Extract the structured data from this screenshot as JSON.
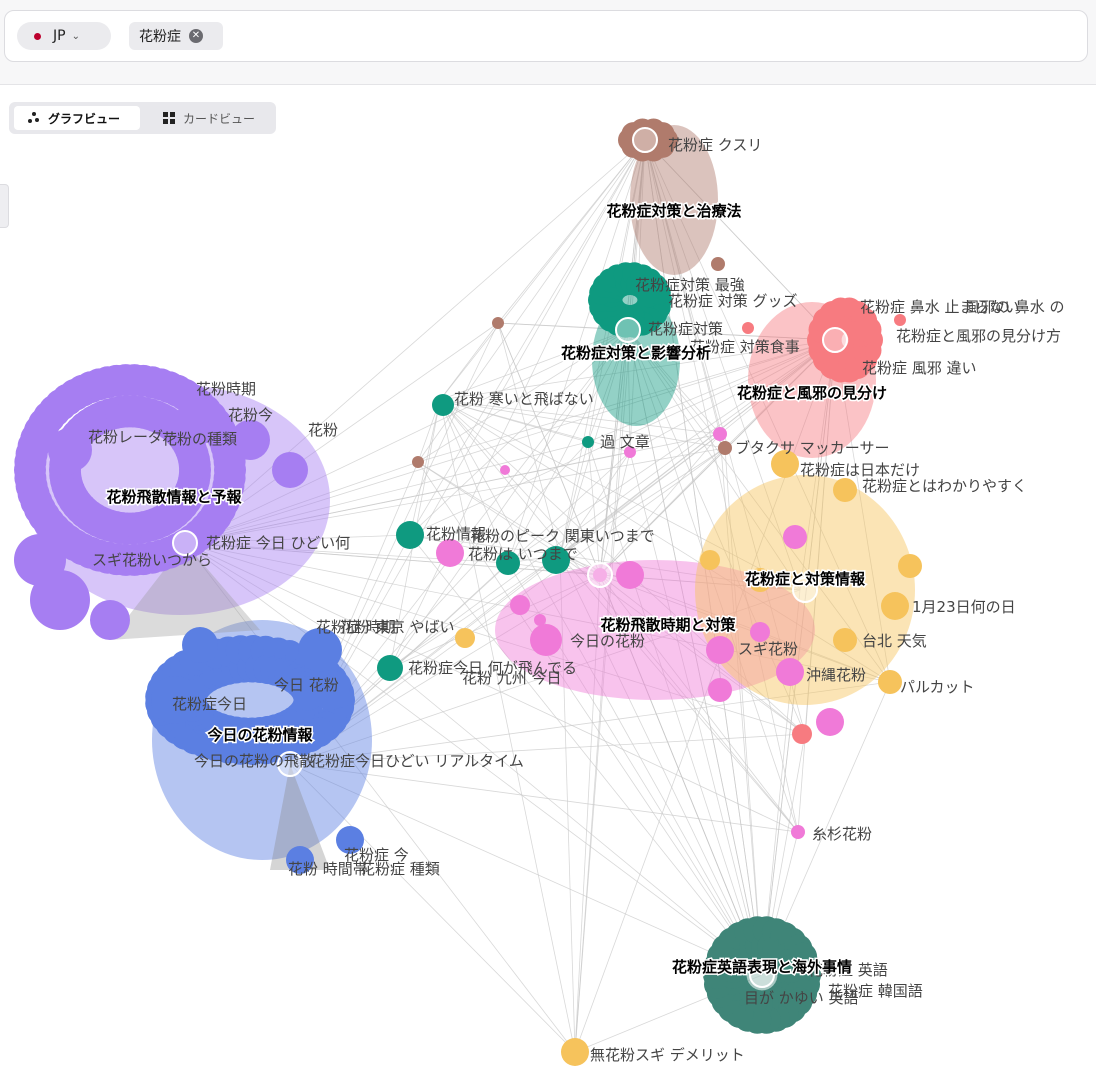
{
  "search": {
    "country_code": "JP",
    "keyword": "花粉症",
    "flag_icon": "japan-flag-icon",
    "remove_icon": "close-circle-icon"
  },
  "view_toggle": {
    "graph_label": "グラフビュー",
    "card_label": "カードビュー",
    "active": "graph"
  },
  "colors": {
    "purple": "#a67ef2",
    "blue": "#5b7fe2",
    "brown": "#b07b6c",
    "teal": "#0f9a80",
    "red": "#f77b80",
    "pink": "#f07ad8",
    "orange": "#f6c35c",
    "darkteal": "#3f8578",
    "edge": "#c8c8c8"
  },
  "clusters": [
    {
      "id": "purple",
      "label": "花粉飛散情報と予報",
      "color": "purple"
    },
    {
      "id": "blue",
      "label": "今日の花粉情報",
      "color": "blue"
    },
    {
      "id": "brown",
      "label": "花粉症対策と治療法",
      "color": "brown"
    },
    {
      "id": "teal",
      "label": "花粉症対策と影響分析",
      "color": "teal"
    },
    {
      "id": "red",
      "label": "花粉症と風邪の見分け",
      "color": "red"
    },
    {
      "id": "pink",
      "label": "花粉飛散時期と対策",
      "color": "pink"
    },
    {
      "id": "orange",
      "label": "花粉症と対策情報",
      "color": "orange"
    },
    {
      "id": "darkteal",
      "label": "花粉症英語表現と海外事情",
      "color": "darkteal"
    }
  ],
  "node_labels": [
    "花粉症 クスリ",
    "花粉症対策 最強",
    "花粉症 対策 グッズ",
    "花粉症対策",
    "花粉症 対策食事",
    "花粉症 鼻水 止まらない",
    "風邪の 鼻水 の",
    "花粉症と風邪の見分け方",
    "花粉症 風邪 違い",
    "花粉時期",
    "花粉今",
    "花粉",
    "花粉レーダー",
    "花粉の種類",
    "花粉 寒いと飛ばない",
    "過 文章",
    "ブタクサ マッカーサー",
    "花粉症は日本だけ",
    "花粉症とはわかりやすく",
    "花粉症 今日 ひどい何",
    "スギ花粉いつから",
    "花粉情報",
    "花粉のピーク 関東いつまで",
    "花粉は いつまで",
    "スギ花粉",
    "1月23日何の日",
    "台北 天気",
    "今日の花粉",
    "花粉症 時期",
    "花粉 東京 やばい",
    "花粉症今日 何が飛んでる",
    "花粉 九州 今日",
    "沖縄花粉",
    "パルカット",
    "花粉症今日",
    "今日 花粉",
    "今日の花粉の飛散",
    "花粉症今日ひどい リアルタイム",
    "糸杉花粉",
    "花粉症 今",
    "花粉 時間帯",
    "花粉症 種類",
    "花粉症 英語",
    "花粉症 韓国語",
    "目が かゆい 英語",
    "無花粉スギ デメリット"
  ]
}
